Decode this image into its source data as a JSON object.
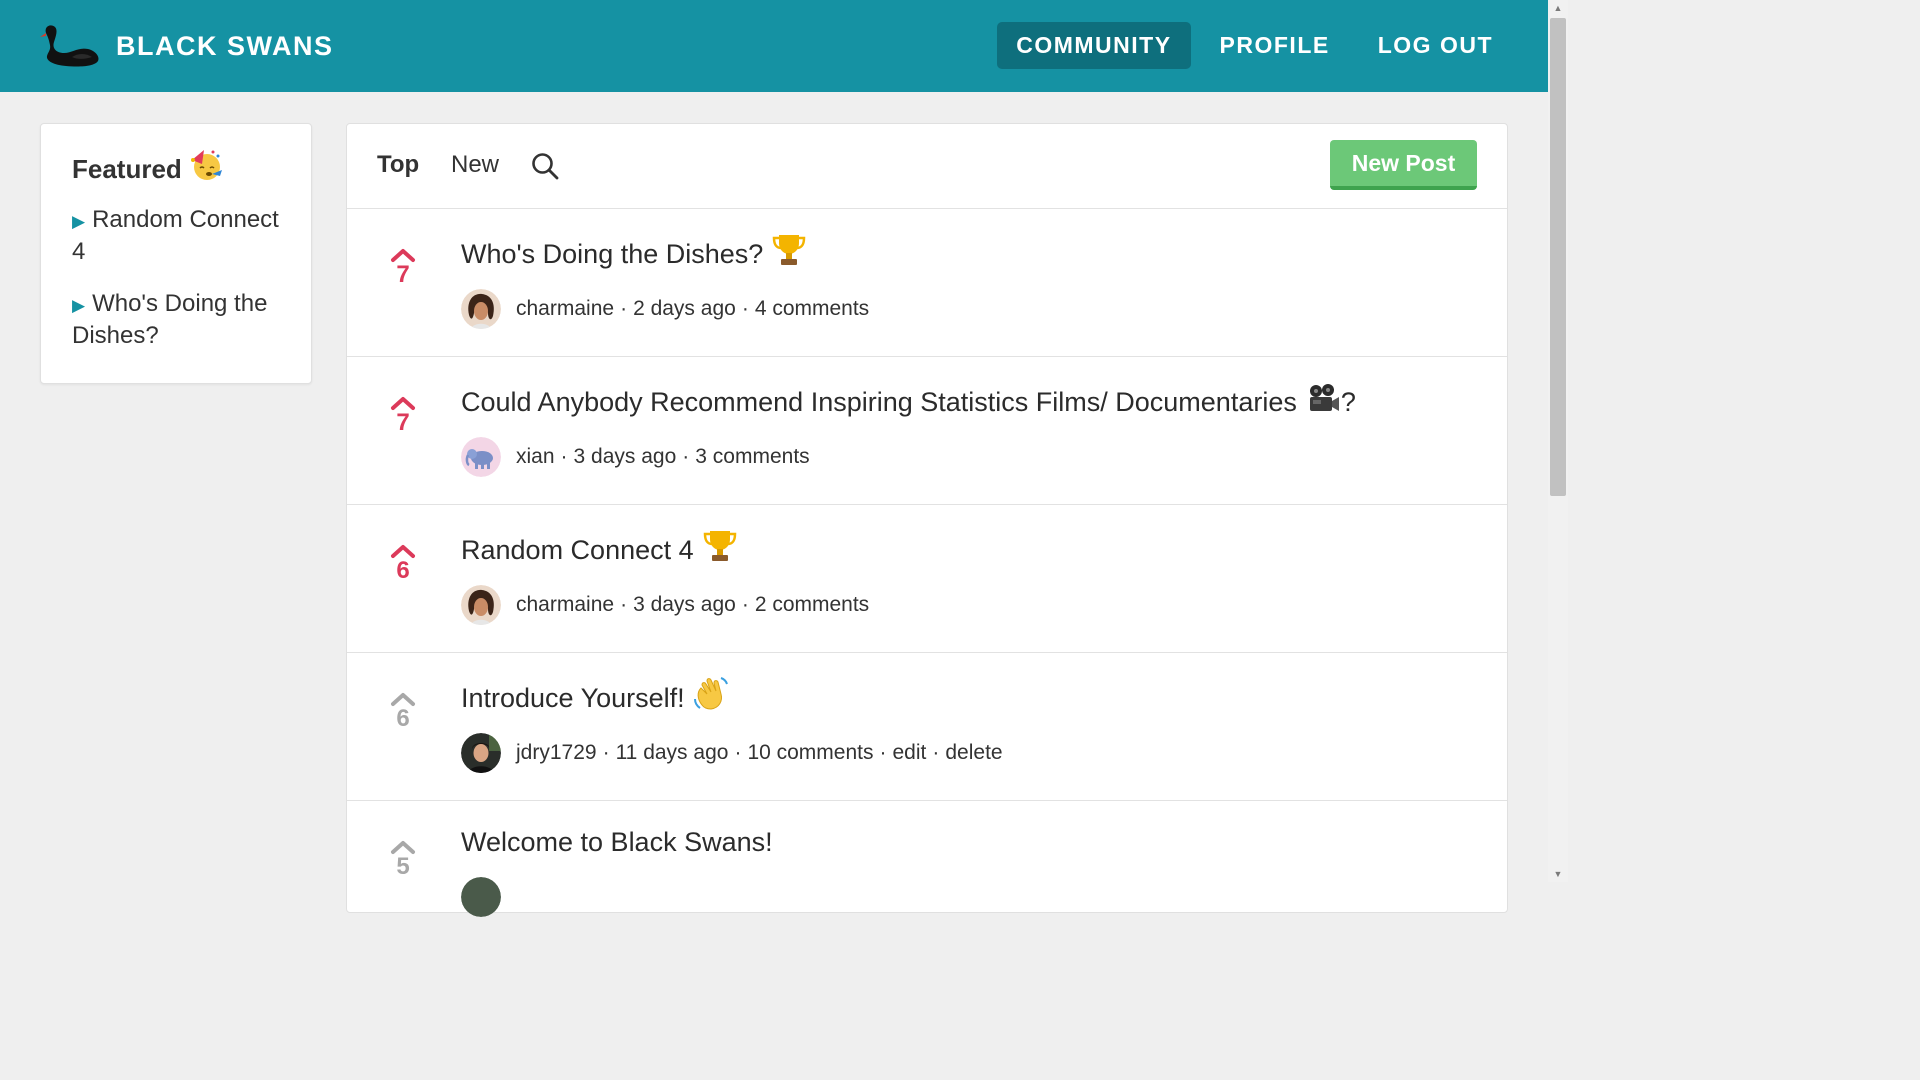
{
  "header": {
    "brand": "BLACK SWANS",
    "nav": [
      "COMMUNITY",
      "PROFILE",
      "LOG OUT"
    ]
  },
  "colors": {
    "header_bg": "#1592a3",
    "nav_active_bg": "#0e6f7d",
    "accent_teal": "#1592a3",
    "upvote_red": "#dc3a5a",
    "vote_gray": "#a8a8a8",
    "new_post_green": "#6cc878"
  },
  "sidebar": {
    "title": "Featured",
    "title_icon": "partying-face-icon",
    "items": [
      {
        "label": "Random Connect 4"
      },
      {
        "label": "Who's Doing the Dishes?"
      }
    ]
  },
  "toolbar": {
    "tabs": [
      "Top",
      "New"
    ],
    "active_tab": "Top",
    "search_icon": "search-icon",
    "new_post": "New Post"
  },
  "posts": [
    {
      "votes": "7",
      "upvoted": true,
      "title": "Who's Doing the Dishes?",
      "title_icon": "trophy-icon",
      "author": "charmaine",
      "avatar_icon": "avatar-charmaine",
      "age": "2 days ago",
      "comments": "4 comments"
    },
    {
      "votes": "7",
      "upvoted": true,
      "title": "Could Anybody Recommend Inspiring Statistics Films/ Documentaries",
      "title_icon": "film-projector-icon",
      "title_suffix": "?",
      "author": "xian",
      "avatar_icon": "avatar-elephant",
      "age": "3 days ago",
      "comments": "3 comments"
    },
    {
      "votes": "6",
      "upvoted": true,
      "title": "Random Connect 4",
      "title_icon": "trophy-icon",
      "author": "charmaine",
      "avatar_icon": "avatar-charmaine",
      "age": "3 days ago",
      "comments": "2 comments"
    },
    {
      "votes": "6",
      "upvoted": false,
      "title": "Introduce Yourself!",
      "title_icon": "waving-hand-icon",
      "author": "jdry1729",
      "avatar_icon": "avatar-jdry",
      "age": "11 days ago",
      "comments": "10 comments",
      "edit": "edit",
      "delete": "delete"
    },
    {
      "votes": "5",
      "upvoted": false,
      "title": "Welcome to Black Swans!"
    }
  ]
}
